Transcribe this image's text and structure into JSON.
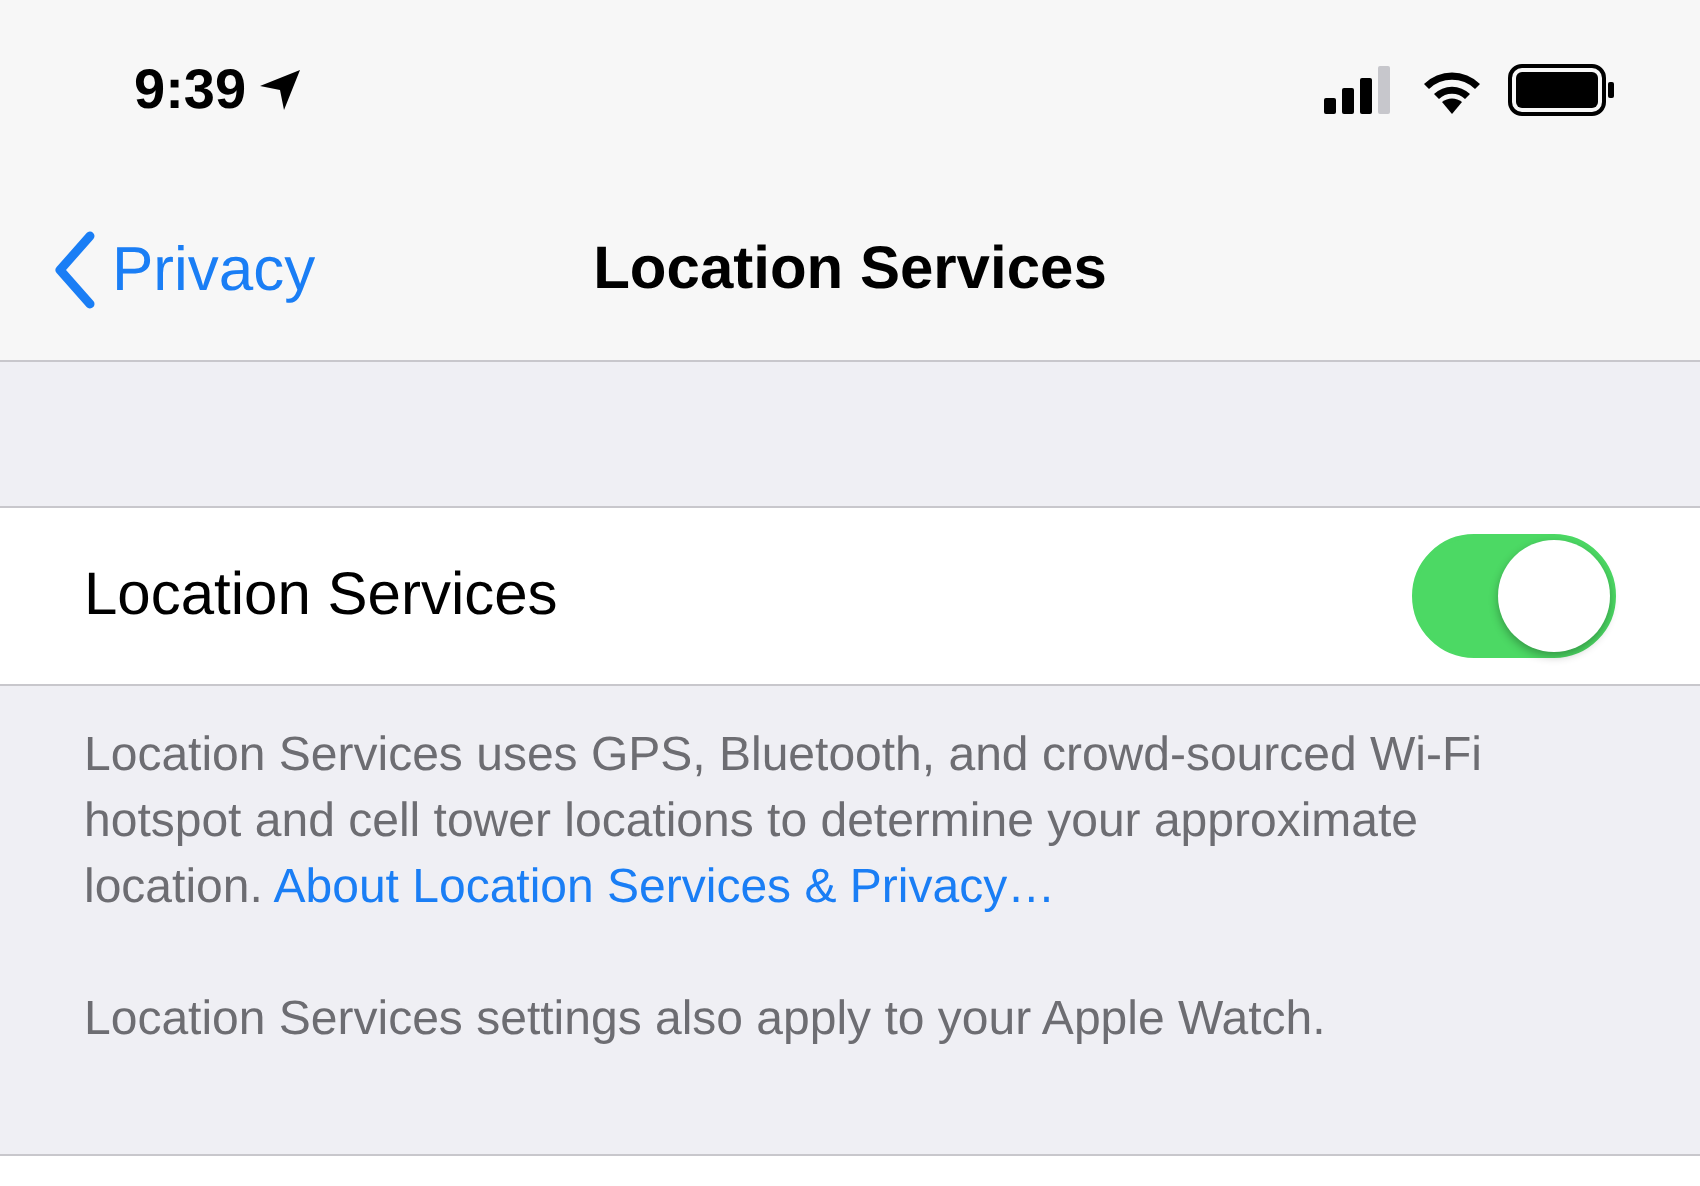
{
  "status_bar": {
    "time": "9:39"
  },
  "nav": {
    "back": "Privacy",
    "title": "Location Services"
  },
  "toggle_row": {
    "label": "Location Services",
    "on": true
  },
  "footer": [
    {
      "text": "Location Services uses GPS, Bluetooth, and crowd-sourced Wi-Fi hotspot and cell tower locations to determine your approximate location. ",
      "link": "About Location Services & Privacy…"
    },
    {
      "text": "Location Services settings also apply to your Apple Watch."
    }
  ]
}
